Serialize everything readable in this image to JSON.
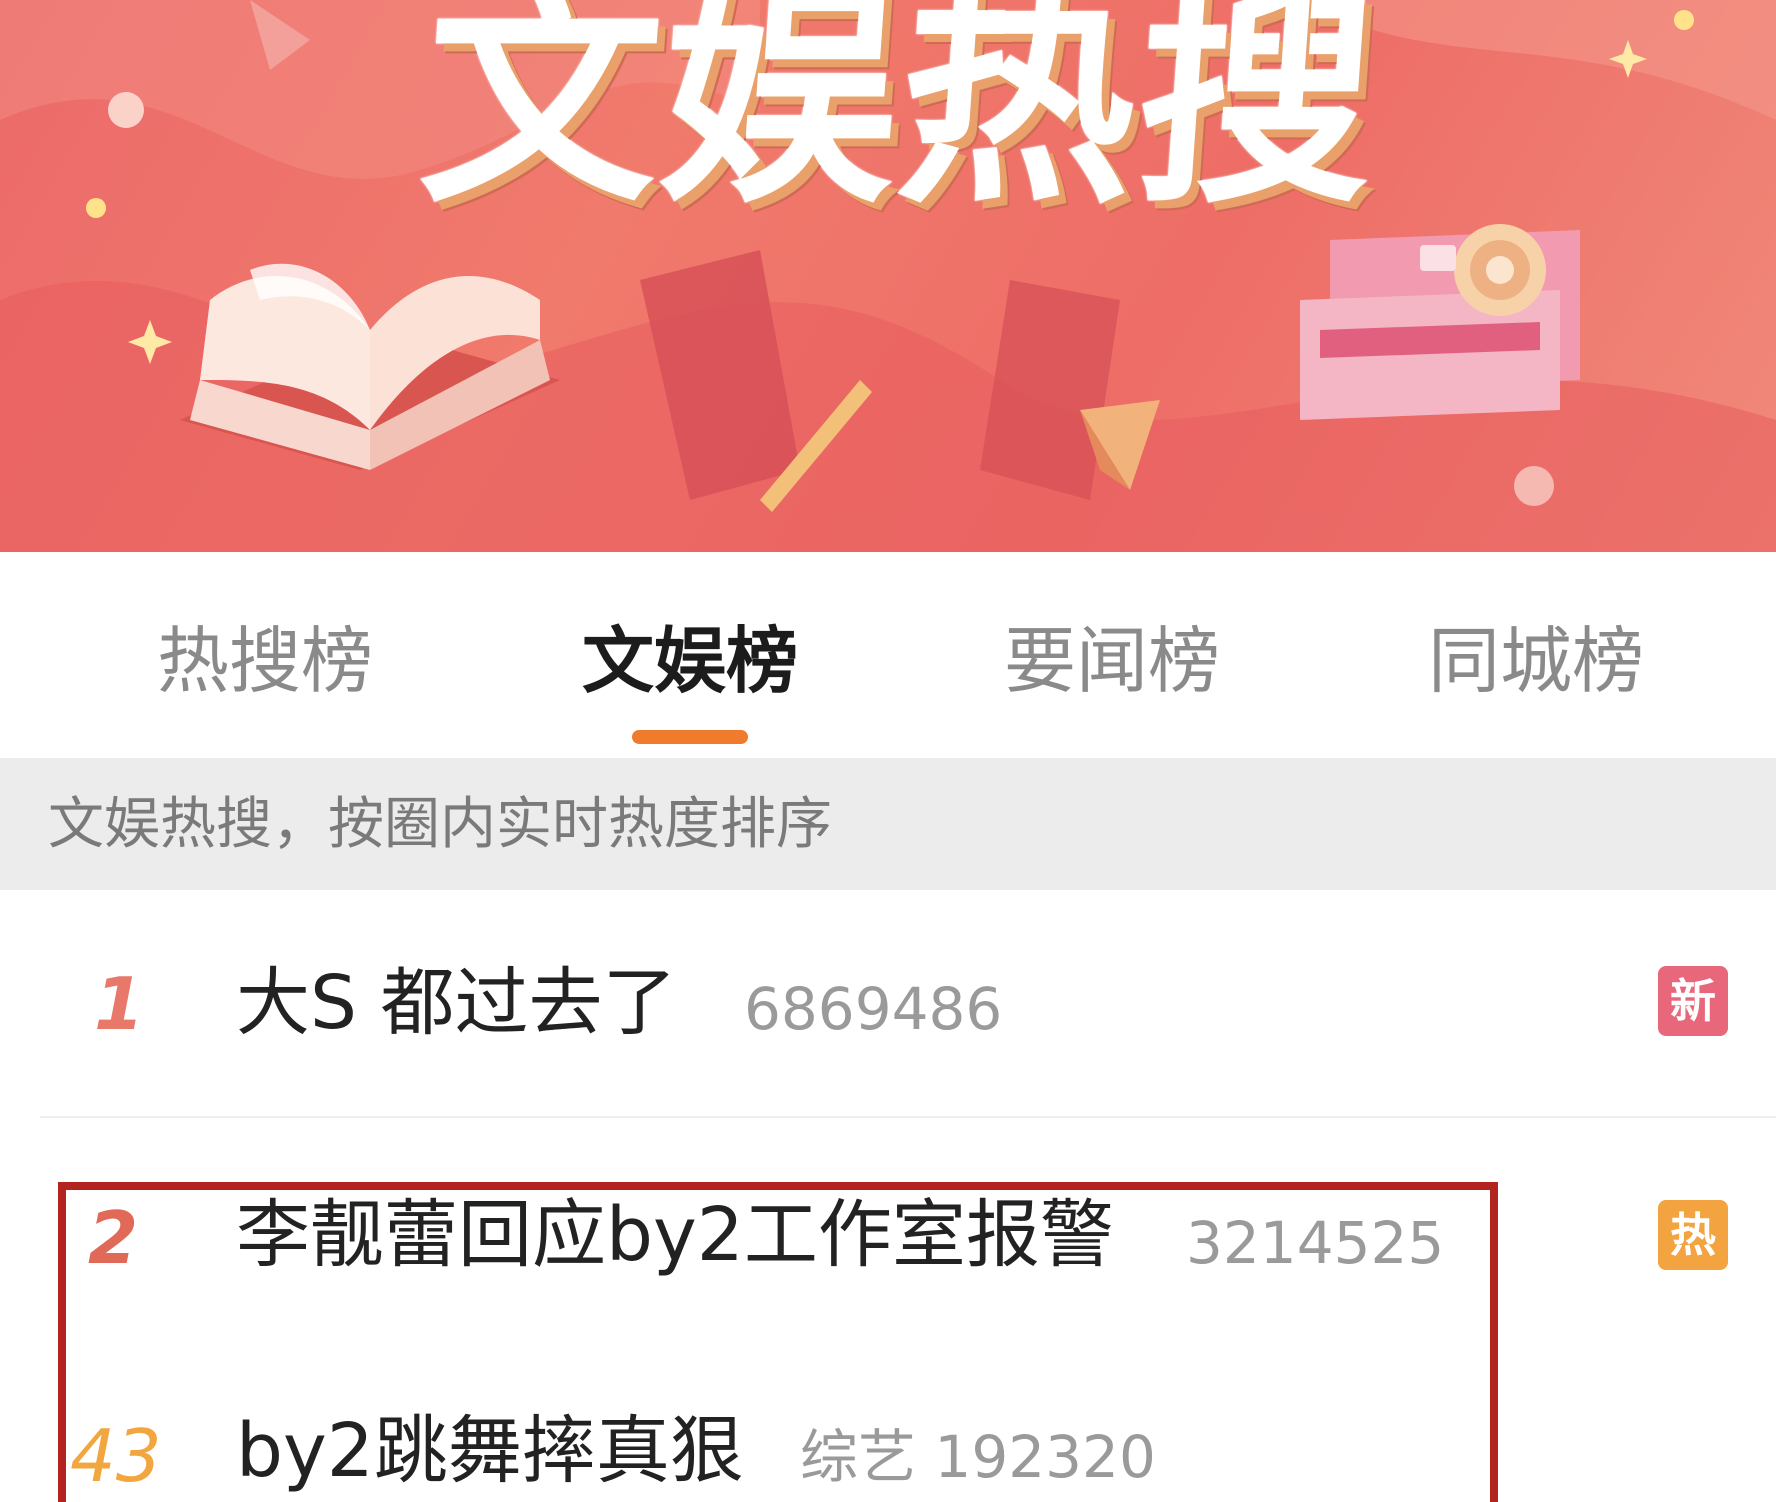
{
  "banner": {
    "title": "文娱热搜"
  },
  "tabs": [
    {
      "label": "热搜榜",
      "active": false
    },
    {
      "label": "文娱榜",
      "active": true
    },
    {
      "label": "要闻榜",
      "active": false
    },
    {
      "label": "同城榜",
      "active": false
    }
  ],
  "subtitle": "文娱热搜，按圈内实时热度排序",
  "items": [
    {
      "rank": "1",
      "title": "大S 都过去了",
      "count": "6869486",
      "badge": "新",
      "badge_color": "#e8677a"
    },
    {
      "rank": "2",
      "title": "李靓蕾回应by2工作室报警",
      "count": "3214525",
      "badge": "热",
      "badge_color": "#f3a340"
    },
    {
      "rank": "43",
      "title": "by2跳舞摔真狠",
      "count": "综艺 192320"
    }
  ],
  "colors": {
    "tab_underline": "#f07b2c",
    "highlight_box": "#b4241f",
    "banner_bg": "#ee6d67"
  }
}
